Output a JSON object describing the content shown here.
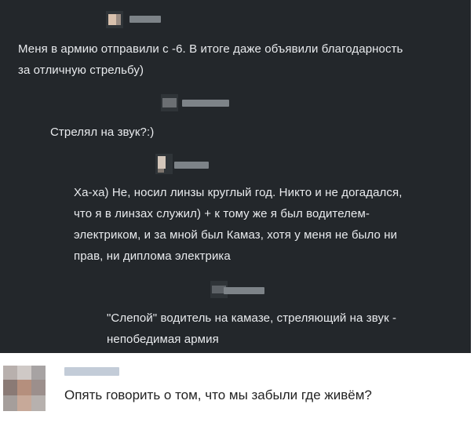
{
  "comments": [
    {
      "lines": [
        "Меня в армию отправили с -6. В итоге даже объявили благодарность",
        "за отличную стрельбу)"
      ]
    },
    {
      "lines": [
        "Стрелял на звук?:)"
      ]
    },
    {
      "lines": [
        "Ха-ха) Не, носил линзы круглый год. Никто и не догадался,",
        "что я в линзах служил) + к тому же я был водителем-",
        "электриком, и за мной был Камаз, хотя у меня не было ни",
        "прав, ни диплома электрика"
      ]
    },
    {
      "lines": [
        "\"Слепой\" водитель на камазе, стреляющий на звук  -",
        "непобедимая армия"
      ]
    }
  ],
  "reply": {
    "text": "Опять говорить о том, что мы забыли где живём?"
  },
  "colors": {
    "dark_background": "#23272b",
    "comment_text": "#e9ebee",
    "reply_text": "#222222"
  }
}
